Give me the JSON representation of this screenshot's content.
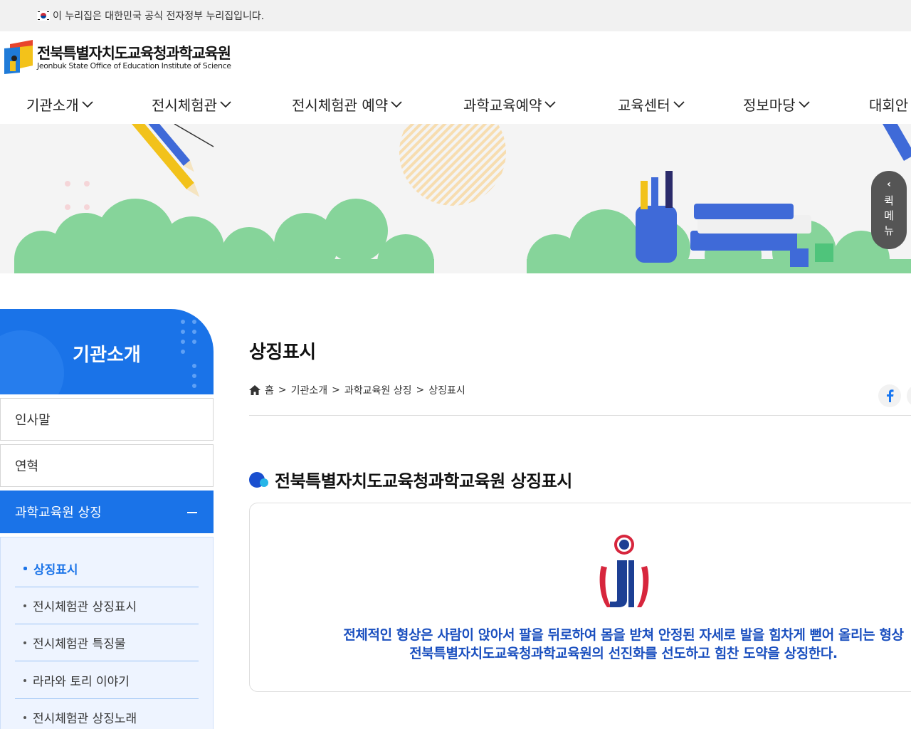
{
  "gov_banner": {
    "text": "이 누리집은 대한민국 공식 전자정부 누리집입니다."
  },
  "logo": {
    "name_ko": "전북특별자치도교육청과학교육원",
    "name_en": "Jeonbuk State Office of Education Institute of Science"
  },
  "gnb": {
    "items": [
      {
        "label": "기관소개"
      },
      {
        "label": "전시체험관"
      },
      {
        "label": "전시체험관 예약"
      },
      {
        "label": "과학교육예약"
      },
      {
        "label": "교육센터"
      },
      {
        "label": "정보마당"
      },
      {
        "label": "대회안"
      }
    ]
  },
  "quick_menu": {
    "label": "퀵메뉴"
  },
  "lnb": {
    "title": "기관소개",
    "items": [
      {
        "label": "인사말"
      },
      {
        "label": "연혁"
      },
      {
        "label": "과학교육원 상징"
      }
    ],
    "sub_items": [
      {
        "label": "상징표시"
      },
      {
        "label": "전시체험관 상징표시"
      },
      {
        "label": "전시체험관 특징물"
      },
      {
        "label": "라라와 토리 이야기"
      },
      {
        "label": "전시체험관 상징노래"
      }
    ]
  },
  "content": {
    "page_title": "상징표시",
    "breadcrumb": [
      "홈",
      "기관소개",
      "과학교육원 상징",
      "상징표시"
    ],
    "breadcrumb_sep": ">",
    "section_title": "전북특별자치도교육청과학교육원 상징표시",
    "description_line1": "전체적인 형상은 사람이 앉아서 팔을 뒤로하여 몸을 받쳐 안정된 자세로 발을 힘차게 뻗어 올리는 형상",
    "description_line2": "전북특별자치도교육청과학교육원의 선진화를 선도하고 힘찬 도약을 상징한다."
  },
  "colors": {
    "primary": "#1a73e8",
    "emblem_red": "#d7263d",
    "emblem_navy": "#1c3f94",
    "cloud_green": "#86d49a"
  }
}
